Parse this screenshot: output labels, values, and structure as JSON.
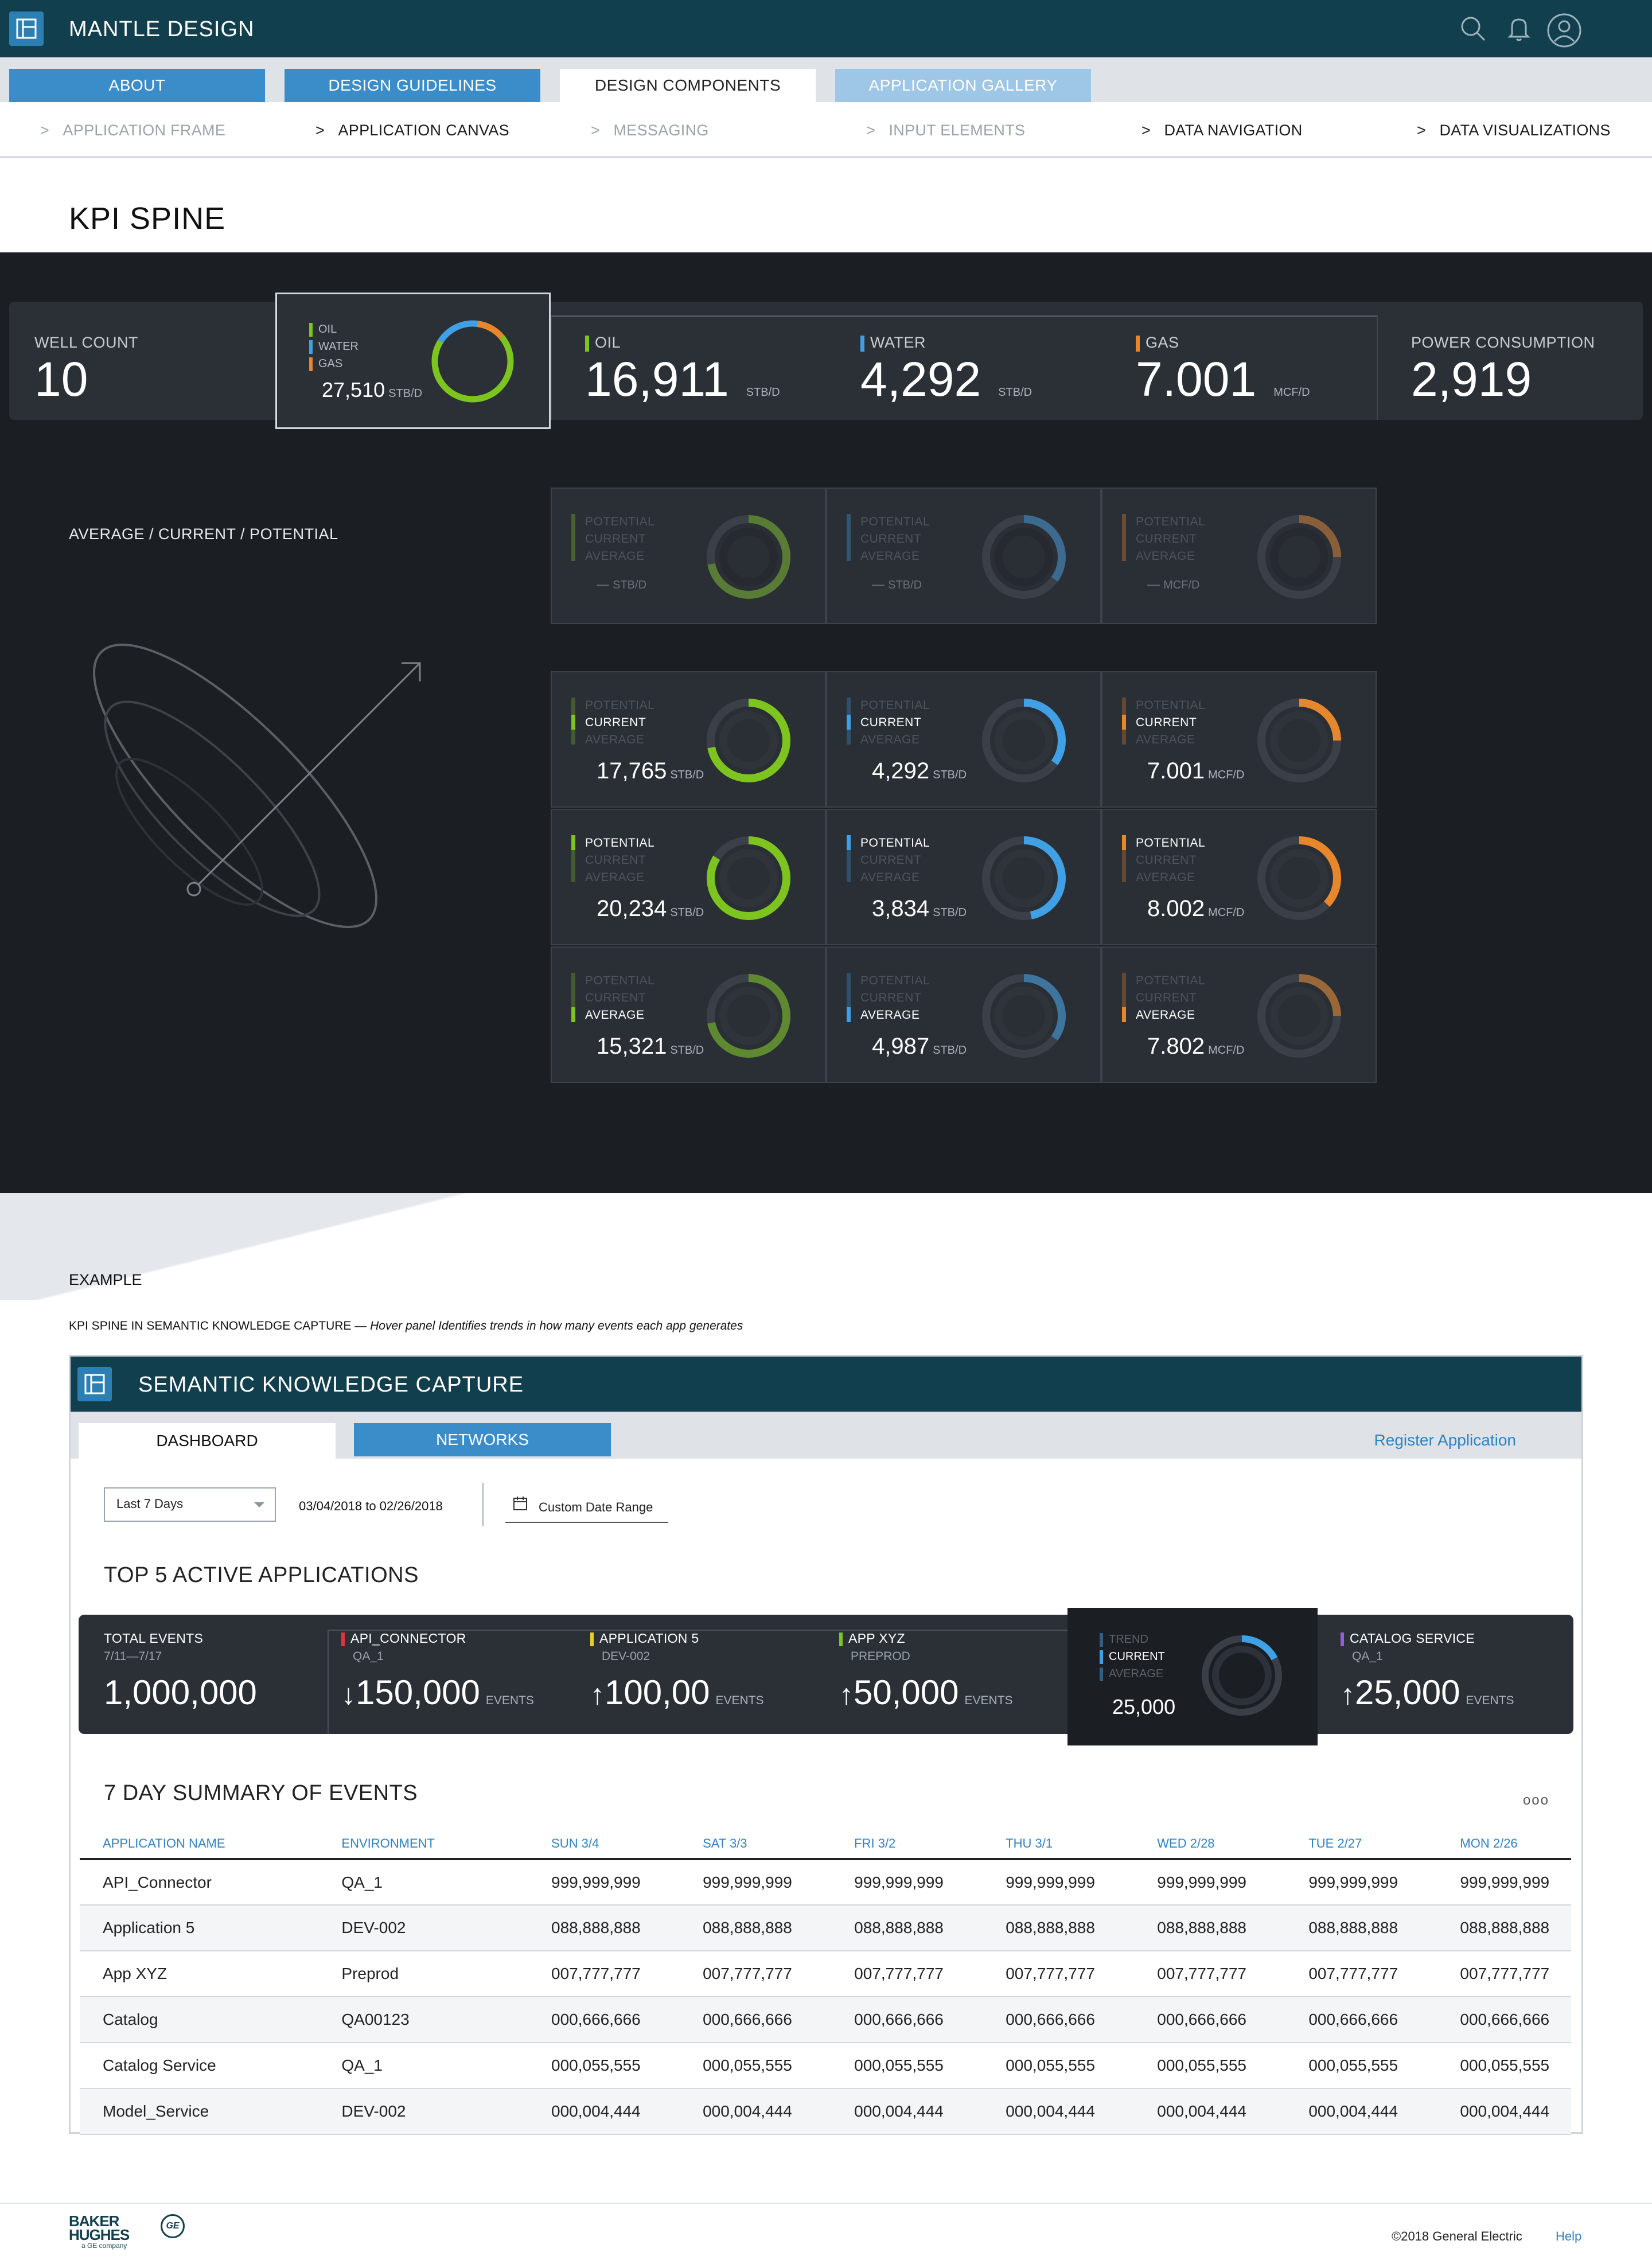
{
  "header": {
    "title": "MANTLE DESIGN"
  },
  "tabs": [
    {
      "label": "ABOUT"
    },
    {
      "label": "DESIGN GUIDELINES"
    },
    {
      "label": "DESIGN COMPONENTS"
    },
    {
      "label": "APPLICATION GALLERY"
    }
  ],
  "subnav": [
    {
      "label": "APPLICATION FRAME"
    },
    {
      "label": "APPLICATION CANVAS"
    },
    {
      "label": "MESSAGING"
    },
    {
      "label": "INPUT ELEMENTS"
    },
    {
      "label": "DATA NAVIGATION"
    },
    {
      "label": "DATA VISUALIZATIONS"
    }
  ],
  "page_title": "KPI SPINE",
  "spine": {
    "well_count_label": "WELL COUNT",
    "well_count": "10",
    "selected": {
      "oil": "OIL",
      "water": "WATER",
      "gas": "GAS",
      "value": "27,510",
      "unit": "STB/D"
    },
    "oil": {
      "label": "OIL",
      "value": "16,911",
      "unit": "STB/D"
    },
    "water": {
      "label": "WATER",
      "value": "4,292",
      "unit": "STB/D"
    },
    "gas": {
      "label": "GAS",
      "value": "7.001",
      "unit": "MCF/D"
    },
    "power": {
      "label": "POWER CONSUMPTION",
      "value": "2,919"
    }
  },
  "acp_label": "AVERAGE / CURRENT / POTENTIAL",
  "tile_labels": {
    "potential": "POTENTIAL",
    "current": "CURRENT",
    "average": "AVERAGE"
  },
  "empty_tiles": [
    {
      "dash": "—",
      "unit": "STB/D"
    },
    {
      "dash": "—",
      "unit": "STB/D"
    },
    {
      "dash": "—",
      "unit": "MCF/D"
    }
  ],
  "tiles": {
    "current": [
      {
        "value": "17,765",
        "unit": "STB/D"
      },
      {
        "value": "4,292",
        "unit": "STB/D"
      },
      {
        "value": "7.001",
        "unit": "MCF/D"
      }
    ],
    "potential": [
      {
        "value": "20,234",
        "unit": "STB/D"
      },
      {
        "value": "3,834",
        "unit": "STB/D"
      },
      {
        "value": "8.002",
        "unit": "MCF/D"
      }
    ],
    "average": [
      {
        "value": "15,321",
        "unit": "STB/D"
      },
      {
        "value": "4,987",
        "unit": "STB/D"
      },
      {
        "value": "7.802",
        "unit": "MCF/D"
      }
    ]
  },
  "colors": {
    "oil": "#7dc41f",
    "water": "#3fa0e6",
    "gas": "#e8862c",
    "header": "#123f4e",
    "accent": "#3b8dc9"
  },
  "example": {
    "heading": "EXAMPLE",
    "caption_main": "KPI SPINE IN SEMANTIC KNOWLEDGE CAPTURE — ",
    "caption_italic": "Hover panel Identifies trends in how many events each app generates"
  },
  "app": {
    "title": "SEMANTIC KNOWLEDGE CAPTURE",
    "tabs": [
      {
        "label": "DASHBOARD"
      },
      {
        "label": "NETWORKS"
      }
    ],
    "register": "Register Application",
    "range_select": "Last 7 Days",
    "date_range": "03/04/2018 to 02/26/2018",
    "custom_range": "Custom Date Range",
    "top5_title": "TOP 5 ACTIVE APPLICATIONS",
    "total": {
      "label": "TOTAL EVENTS",
      "sub": "7/11—7/17",
      "value": "1,000,000"
    },
    "apps": [
      {
        "name": "API_CONNECTOR",
        "env": "QA_1",
        "arrow": "↓",
        "value": "150,000",
        "unit": "EVENTS",
        "color": "#e0353b"
      },
      {
        "name": "APPLICATION 5",
        "env": "DEV-002",
        "arrow": "↑",
        "value": "100,00",
        "unit": "EVENTS",
        "color": "#e6d220"
      },
      {
        "name": "APP XYZ",
        "env": "PREPROD",
        "arrow": "↑",
        "value": "50,000",
        "unit": "EVENTS",
        "color": "#7dc41f"
      },
      {
        "name": "CATALOG SERVICE",
        "env": "QA_1",
        "arrow": "↑",
        "value": "25,000",
        "unit": "EVENTS",
        "color": "#9b59e0"
      }
    ],
    "hover": {
      "trend": "TREND",
      "current": "CURRENT",
      "average": "AVERAGE",
      "value": "25,000"
    },
    "summary_title": "7 DAY SUMMARY OF EVENTS",
    "more": "ooo",
    "columns": [
      "APPLICATION NAME",
      "ENVIRONMENT",
      "SUN 3/4",
      "SAT 3/3",
      "FRI 3/2",
      "THU 3/1",
      "WED 2/28",
      "TUE 2/27",
      "MON 2/26"
    ],
    "rows": [
      [
        "API_Connector",
        "QA_1",
        "999,999,999",
        "999,999,999",
        "999,999,999",
        "999,999,999",
        "999,999,999",
        "999,999,999",
        "999,999,999"
      ],
      [
        "Application 5",
        "DEV-002",
        "088,888,888",
        "088,888,888",
        "088,888,888",
        "088,888,888",
        "088,888,888",
        "088,888,888",
        "088,888,888"
      ],
      [
        "App XYZ",
        "Preprod",
        "007,777,777",
        "007,777,777",
        "007,777,777",
        "007,777,777",
        "007,777,777",
        "007,777,777",
        "007,777,777"
      ],
      [
        "Catalog",
        "QA00123",
        "000,666,666",
        "000,666,666",
        "000,666,666",
        "000,666,666",
        "000,666,666",
        "000,666,666",
        "000,666,666"
      ],
      [
        "Catalog Service",
        "QA_1",
        "000,055,555",
        "000,055,555",
        "000,055,555",
        "000,055,555",
        "000,055,555",
        "000,055,555",
        "000,055,555"
      ],
      [
        "Model_Service",
        "DEV-002",
        "000,004,444",
        "000,004,444",
        "000,004,444",
        "000,004,444",
        "000,004,444",
        "000,004,444",
        "000,004,444"
      ]
    ]
  },
  "footer": {
    "brand_line1": "BAKER",
    "brand_line2": "HUGHES",
    "brand_sub": "a GE company",
    "ge": "GE",
    "copyright": "©2018 General Electric",
    "help": "Help"
  }
}
